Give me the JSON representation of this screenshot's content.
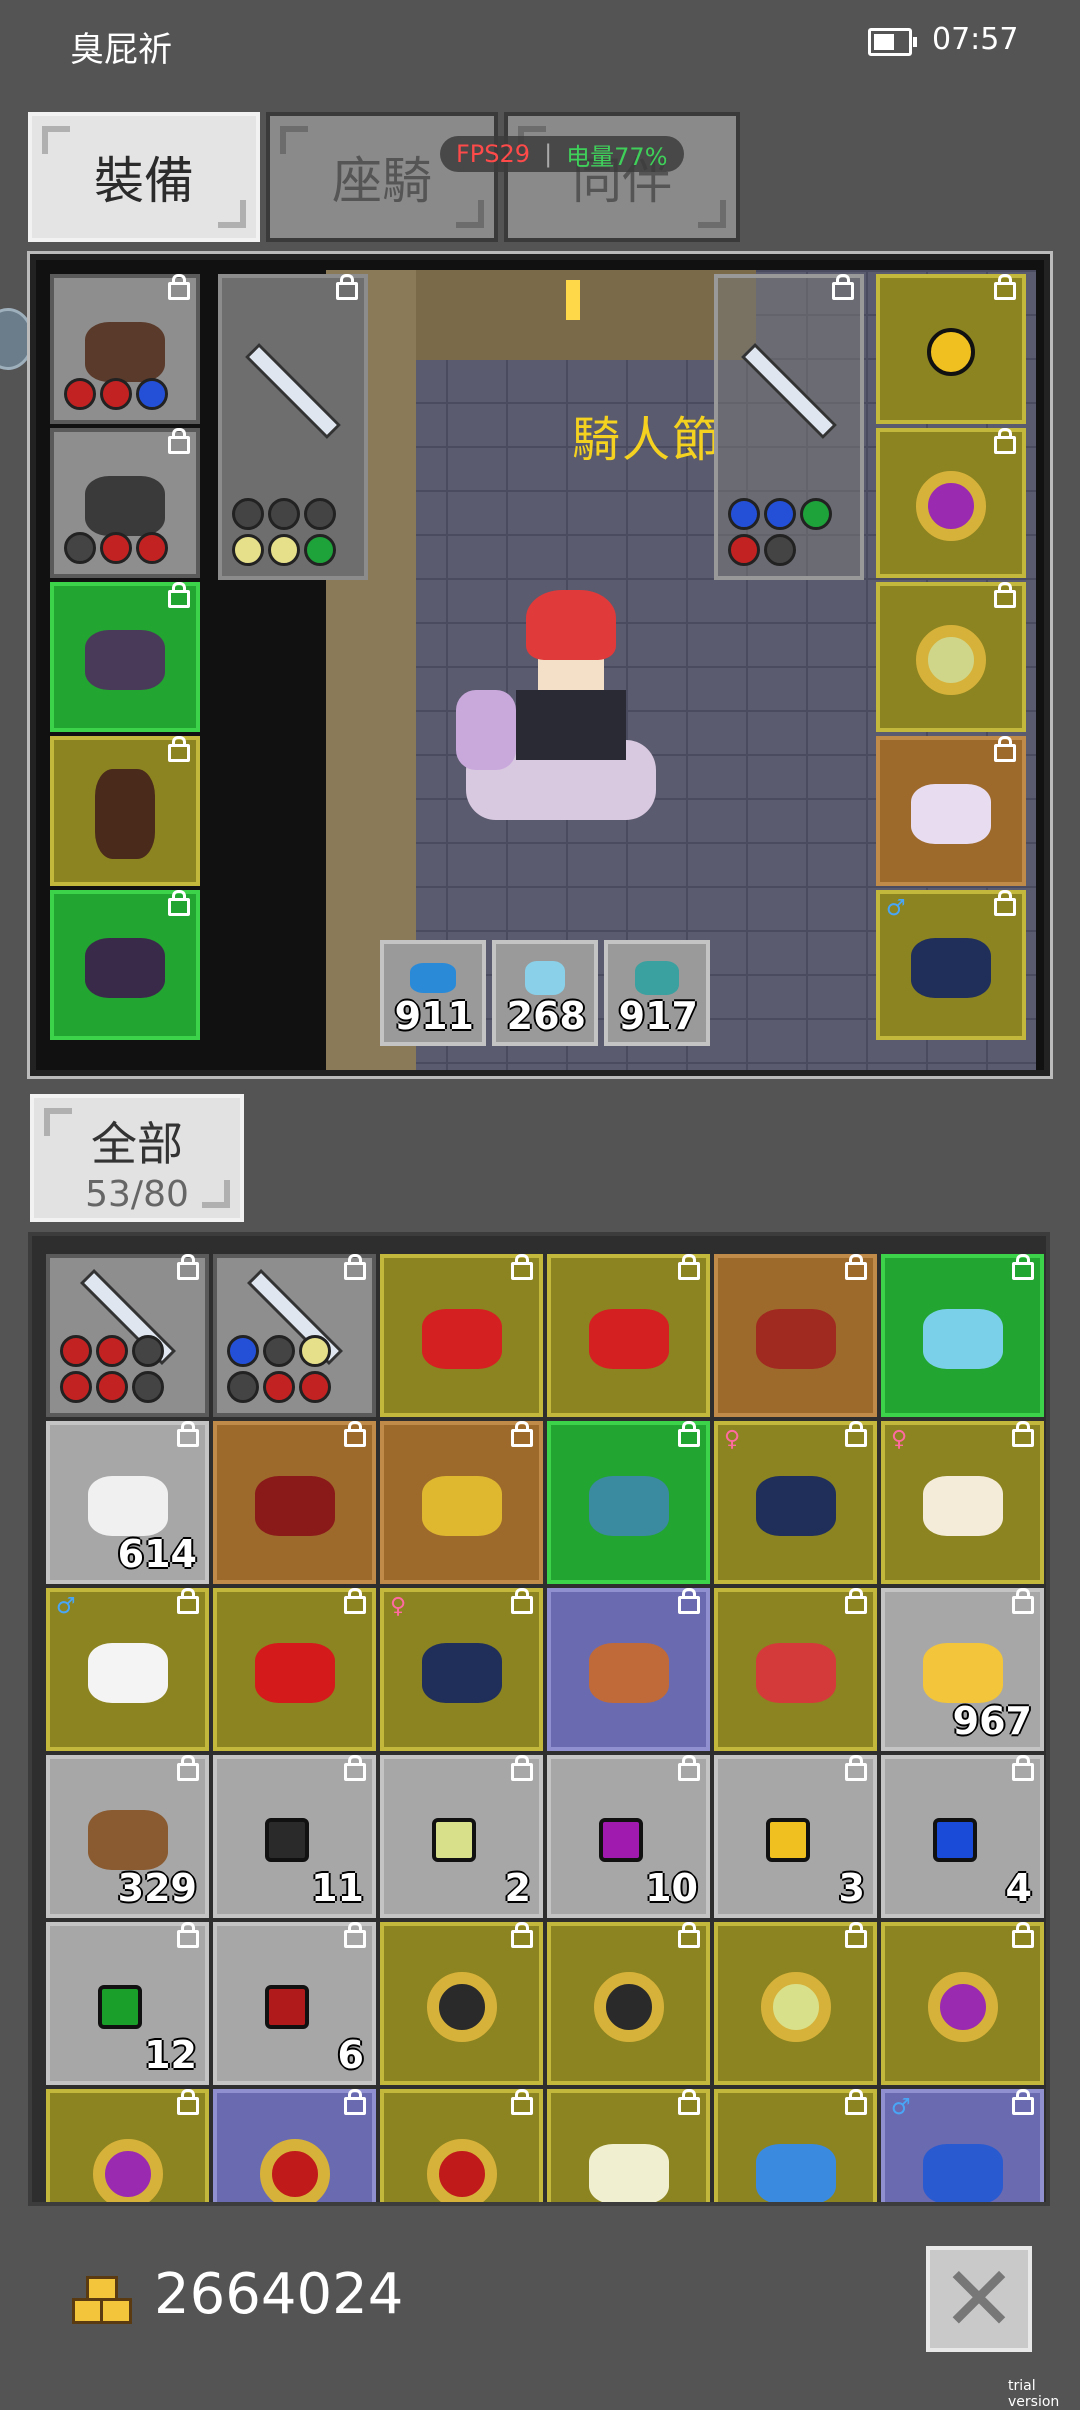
{
  "status_bar": {
    "title": "臭屁祈",
    "time": "07:57"
  },
  "tabs": [
    {
      "label": "裝備",
      "active": true
    },
    {
      "label": "座騎",
      "active": false
    },
    {
      "label": "同伴",
      "active": false
    }
  ],
  "overlay": {
    "fps": "FPS29",
    "separator": "|",
    "battery": "电量77%"
  },
  "scene": {
    "banner": "騎人節",
    "quick_items": [
      {
        "icon": "blue-bird-icon",
        "count": "911"
      },
      {
        "icon": "box-icon",
        "count": "268"
      },
      {
        "icon": "gem-pouch-icon",
        "count": "917"
      }
    ]
  },
  "equipment": {
    "left": [
      {
        "icon": "helmet-icon",
        "rarity": "grey"
      },
      {
        "icon": "armor-icon",
        "rarity": "grey"
      },
      {
        "icon": "gloves-icon",
        "rarity": "green"
      },
      {
        "icon": "boots-icon",
        "rarity": "yellow"
      },
      {
        "icon": "cape-icon",
        "rarity": "green"
      }
    ],
    "weapon_main": {
      "icon": "sword-icon",
      "rarity": "grey"
    },
    "weapon_off": {
      "icon": "sword-icon",
      "rarity": "grey"
    },
    "right": [
      {
        "icon": "amulet-icon",
        "rarity": "yellow"
      },
      {
        "icon": "ring-icon",
        "rarity": "yellow"
      },
      {
        "icon": "ring-icon",
        "rarity": "yellow"
      },
      {
        "icon": "unicorn-mount-icon",
        "rarity": "orange"
      },
      {
        "icon": "penguin-pet-icon",
        "rarity": "yellow",
        "badge": "♂"
      }
    ]
  },
  "inventory_tab": {
    "label": "全部",
    "capacity": "53/80"
  },
  "inventory": [
    {
      "icon": "sword-icon",
      "rarity": "grey",
      "count": ""
    },
    {
      "icon": "sword-icon",
      "rarity": "grey",
      "count": ""
    },
    {
      "icon": "red-bow-icon",
      "rarity": "yellow",
      "count": ""
    },
    {
      "icon": "red-axe-icon",
      "rarity": "yellow",
      "count": ""
    },
    {
      "icon": "red-glove-icon",
      "rarity": "orange",
      "count": ""
    },
    {
      "icon": "crystal-belt-icon",
      "rarity": "green",
      "count": ""
    },
    {
      "icon": "potion-icon",
      "rarity": "light",
      "count": "614"
    },
    {
      "icon": "red-hat-icon",
      "rarity": "orange",
      "count": ""
    },
    {
      "icon": "gold-ring-icon",
      "rarity": "orange",
      "count": ""
    },
    {
      "icon": "blue-armor-icon",
      "rarity": "green",
      "count": ""
    },
    {
      "icon": "penguin-pet-icon",
      "rarity": "yellow",
      "count": "",
      "badge": "♀"
    },
    {
      "icon": "cat-pet-icon",
      "rarity": "yellow",
      "count": "",
      "badge": "♀"
    },
    {
      "icon": "snowman-pet-icon",
      "rarity": "yellow",
      "count": "",
      "badge": "♂"
    },
    {
      "icon": "red-dragon-icon",
      "rarity": "yellow",
      "count": ""
    },
    {
      "icon": "penguin-pet-icon",
      "rarity": "yellow",
      "count": "",
      "badge": "♀"
    },
    {
      "icon": "scroll-icon",
      "rarity": "blue",
      "count": ""
    },
    {
      "icon": "rooster-pet-icon",
      "rarity": "yellow",
      "count": ""
    },
    {
      "icon": "gold-nugget-icon",
      "rarity": "light",
      "count": "967"
    },
    {
      "icon": "ore-icon",
      "rarity": "light",
      "count": "329"
    },
    {
      "icon": "black-gem-icon",
      "rarity": "light",
      "count": "11"
    },
    {
      "icon": "yellow-green-gem-icon",
      "rarity": "light",
      "count": "2"
    },
    {
      "icon": "purple-gem-icon",
      "rarity": "light",
      "count": "10"
    },
    {
      "icon": "yellow-gem-icon",
      "rarity": "light",
      "count": "3"
    },
    {
      "icon": "blue-gem-icon",
      "rarity": "light",
      "count": "4"
    },
    {
      "icon": "green-gem-icon",
      "rarity": "light",
      "count": "12"
    },
    {
      "icon": "red-gem-icon",
      "rarity": "light",
      "count": "6"
    },
    {
      "icon": "black-ring-icon",
      "rarity": "yellow",
      "count": ""
    },
    {
      "icon": "black-ring-icon",
      "rarity": "yellow",
      "count": ""
    },
    {
      "icon": "yellow-ring-icon",
      "rarity": "yellow",
      "count": ""
    },
    {
      "icon": "purple-ring-icon",
      "rarity": "yellow",
      "count": ""
    },
    {
      "icon": "purple-ring-icon",
      "rarity": "yellow",
      "count": ""
    },
    {
      "icon": "red-ring-icon",
      "rarity": "blue",
      "count": ""
    },
    {
      "icon": "red-ring-icon",
      "rarity": "yellow",
      "count": ""
    },
    {
      "icon": "white-amulet-icon",
      "rarity": "yellow",
      "count": ""
    },
    {
      "icon": "blue-amulet-icon",
      "rarity": "yellow",
      "count": ""
    },
    {
      "icon": "treasure-chest-pet-icon",
      "rarity": "blue",
      "count": "",
      "badge": "♂"
    }
  ],
  "footer": {
    "gold": "2664024",
    "close_label": "✕"
  },
  "watermark": "trial version",
  "colors": {
    "background": "#545454",
    "grey": "#8e8e8e",
    "green": "#22a531",
    "yellow": "#8c8420",
    "orange": "#9d6a2c",
    "blue": "#6a6ab0",
    "light": "#a7a7a7"
  }
}
